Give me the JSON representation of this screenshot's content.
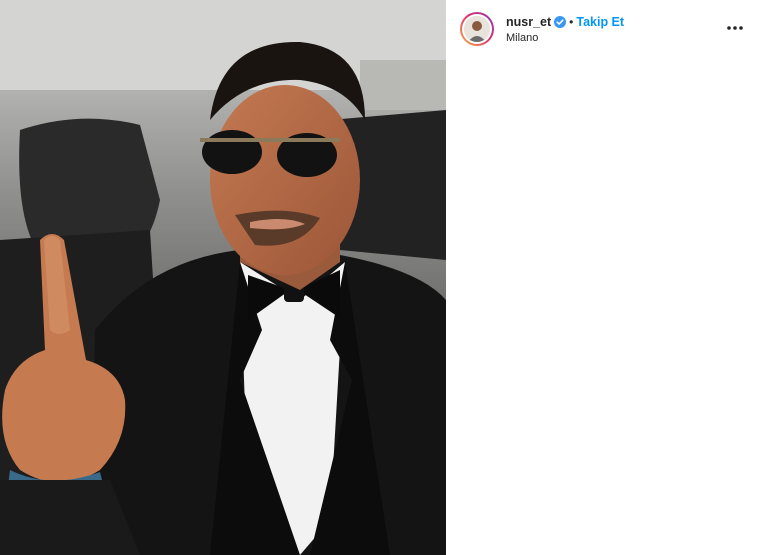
{
  "post": {
    "username": "nusr_et",
    "separator": "•",
    "follow_label": "Takip Et",
    "location": "Milano",
    "verified": true,
    "more_icon": "more-horizontal-icon",
    "accent_color": "#0095f6"
  }
}
